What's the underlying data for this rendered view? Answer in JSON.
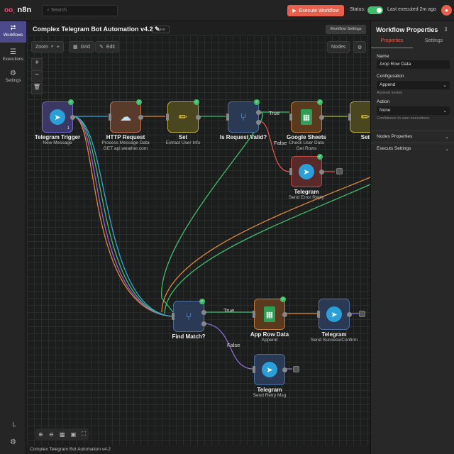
{
  "topbar": {
    "logo": "n8n",
    "search_placeholder": "Search",
    "execute_label": "Execute Workflow",
    "status_label": "Status:",
    "status_on": true,
    "last_executed": "Last executed 2m ago",
    "accent": "#e8604c"
  },
  "sidebar": {
    "items": [
      {
        "label": "Workflows",
        "icon": "share-icon"
      },
      {
        "label": "Executions",
        "icon": "list-icon"
      },
      {
        "label": "Settings",
        "icon": "gear-icon"
      }
    ]
  },
  "workflow": {
    "title": "Complex Telegram Bot Automation v4.2",
    "save_label": "Save",
    "settings_label": "Workflow Settings"
  },
  "toolbar": {
    "zoom": "Zoom",
    "grid": "Grid",
    "edit": "Edit",
    "nodes": "Nodes"
  },
  "nodes": [
    {
      "title": "Telegram Trigger",
      "sub1": "New Message",
      "sub2": "",
      "badge": "1"
    },
    {
      "title": "HTTP Request",
      "sub1": "Process Message Data",
      "sub2": "GET api.weather.com"
    },
    {
      "title": "Set",
      "sub1": "Extract User Info",
      "sub2": ""
    },
    {
      "title": "Is Request Valid?",
      "sub1": "",
      "sub2": ""
    },
    {
      "title": "Google Sheets",
      "sub1": "Check User Data",
      "sub2": "Get Rows"
    },
    {
      "title": "Set",
      "sub1": "",
      "sub2": ""
    },
    {
      "title": "Telegram",
      "sub1": "Send Error Reply",
      "sub2": ""
    },
    {
      "title": "Find Match?",
      "sub1": "",
      "sub2": ""
    },
    {
      "title": "App Row Data",
      "sub1": "Append",
      "sub2": ""
    },
    {
      "title": "Telegram",
      "sub1": "Send Success/Confirm",
      "sub2": ""
    },
    {
      "title": "Telegram",
      "sub1": "Send Retry Msg",
      "sub2": ""
    }
  ],
  "edge_labels": {
    "true1": "True",
    "false1": "False",
    "true2": "True",
    "false2": "False"
  },
  "panel": {
    "title": "Workflow Properties",
    "tabs": [
      "Properties",
      "Settings"
    ],
    "name_label": "Name",
    "name_value": "Arop Row Data",
    "config_label": "Configuration",
    "config_value": "Append",
    "config_help": "Append seskid",
    "action_label": "Action",
    "action_value": "None",
    "action_help": "Confidence to user executions.",
    "sections": [
      "Nodes Properties",
      "Executs Settings"
    ]
  },
  "footer": "Complex Telegram Bot Automation v4.2"
}
